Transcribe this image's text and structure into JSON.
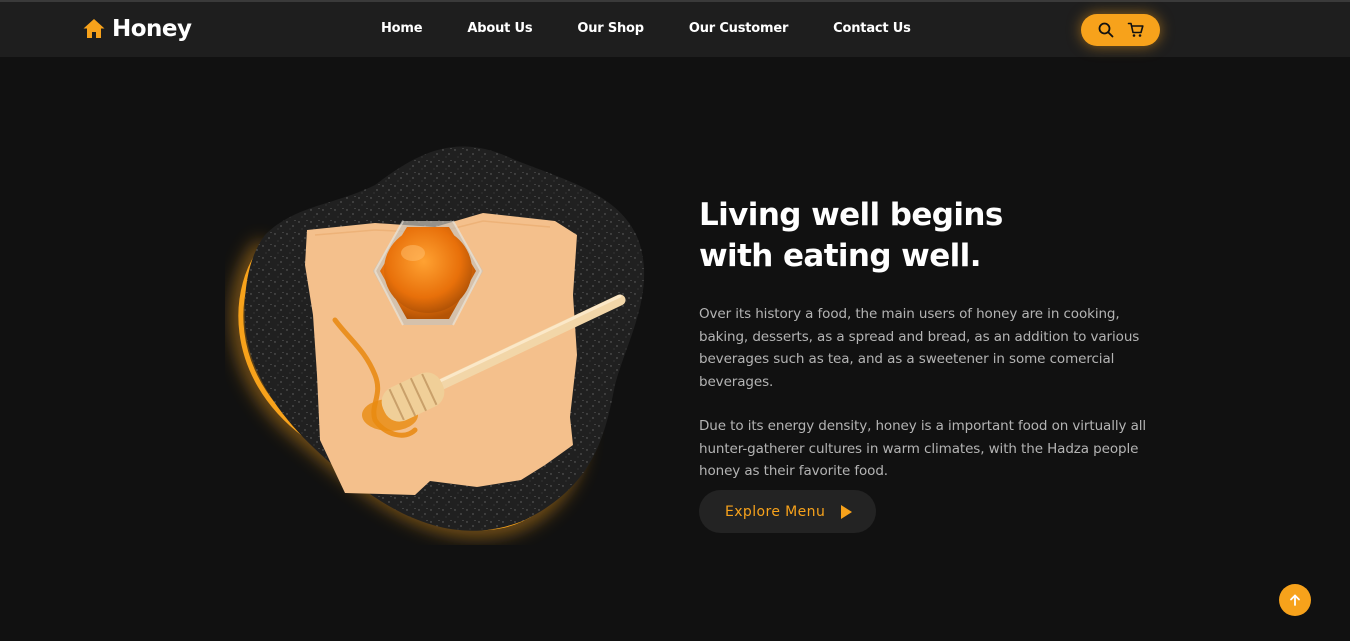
{
  "brand": {
    "name": "Honey",
    "icon": "home-icon",
    "accent": "#f7a21b"
  },
  "nav": {
    "items": [
      {
        "label": "Home"
      },
      {
        "label": "About Us"
      },
      {
        "label": "Our Shop"
      },
      {
        "label": "Our Customer"
      },
      {
        "label": "Contact Us"
      }
    ]
  },
  "tools": {
    "search_icon": "search-icon",
    "cart_icon": "cart-icon"
  },
  "hero": {
    "title_line1": "Living well begins",
    "title_line2": "with eating well.",
    "paragraph1": "Over its history a food, the main users of honey are in cooking, baking, desserts, as a spread and bread, as an addition to various beverages such as tea, and as a sweetener in some comercial beverages.",
    "paragraph2": "Due to its energy density, honey is a important food on virtually all hunter-gatherer cultures in warm climates, with the Hadza people honey as their favorite food.",
    "button_label": "Explore Menu",
    "button_icon": "play-icon"
  },
  "scroll_top": {
    "icon": "arrow-up-icon"
  },
  "colors": {
    "background": "#111111",
    "header": "#1e1e1e",
    "button": "#232323"
  }
}
